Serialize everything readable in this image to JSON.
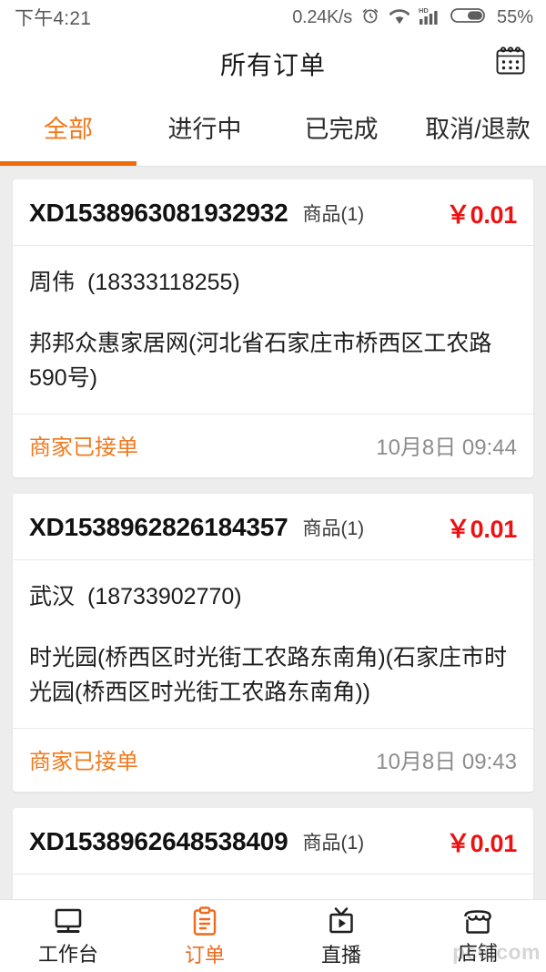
{
  "statusbar": {
    "time": "下午4:21",
    "net_speed": "0.24K/s",
    "alarm_icon": "alarm-icon",
    "wifi_icon": "wifi-icon",
    "hd_label": "HD",
    "signal_icon": "signal-icon",
    "battery_icon": "battery-icon",
    "battery_level": "55%"
  },
  "header": {
    "title": "所有订单",
    "calendar_icon": "calendar-icon"
  },
  "tabs": [
    {
      "label": "全部",
      "active": true
    },
    {
      "label": "进行中",
      "active": false
    },
    {
      "label": "已完成",
      "active": false
    },
    {
      "label": "取消/退款",
      "active": false
    }
  ],
  "orders": [
    {
      "order_no": "XD1538963081932932",
      "goods_count": "商品(1)",
      "price": "￥0.01",
      "customer_name": "周伟",
      "customer_phone": "(18333118255)",
      "address": "邦邦众惠家居网(河北省石家庄市桥西区工农路590号)",
      "status": "商家已接单",
      "time": "10月8日 09:44"
    },
    {
      "order_no": "XD1538962826184357",
      "goods_count": "商品(1)",
      "price": "￥0.01",
      "customer_name": "武汉",
      "customer_phone": "(18733902770)",
      "address": "时光园(桥西区时光街工农路东南角)(石家庄市时光园(桥西区时光街工农路东南角))",
      "status": "商家已接单",
      "time": "10月8日 09:43"
    },
    {
      "order_no": "XD1538962648538409",
      "goods_count": "商品(1)",
      "price": "￥0.01",
      "customer_name": "",
      "customer_phone": "",
      "address": "",
      "status": "",
      "time": ""
    }
  ],
  "bottom_nav": [
    {
      "label": "工作台",
      "icon": "monitor-icon",
      "active": false
    },
    {
      "label": "订单",
      "icon": "clipboard-icon",
      "active": true
    },
    {
      "label": "直播",
      "icon": "tv-play-icon",
      "active": false
    },
    {
      "label": "店铺",
      "icon": "shop-icon",
      "active": false
    }
  ],
  "watermark": "pc6.com",
  "colors": {
    "accent": "#ef6a1b",
    "price_red": "#ee1111",
    "page_bg": "#ededed"
  }
}
